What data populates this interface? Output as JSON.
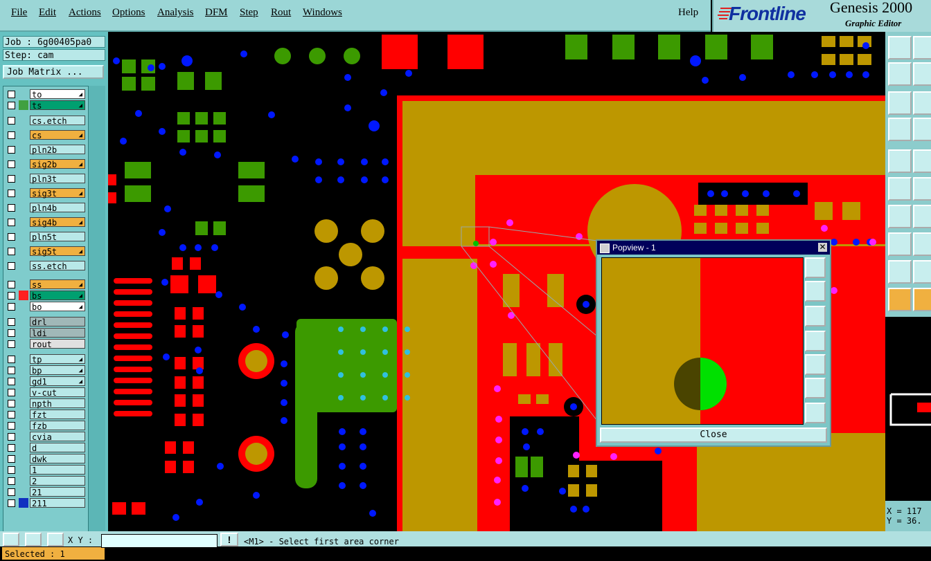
{
  "menu": [
    "File",
    "Edit",
    "Actions",
    "Options",
    "Analysis",
    "DFM",
    "Step",
    "Rout",
    "Windows"
  ],
  "help": "Help",
  "logo": {
    "brand": "Frontline",
    "product": "Genesis 2000",
    "subtitle": "Graphic Editor"
  },
  "job": "Job : 6g00405pa0",
  "step": "Step: cam",
  "job_matrix": "Job Matrix ...",
  "layers": [
    {
      "name": "to",
      "color": "#ffffff",
      "mark": "",
      "arrow": true
    },
    {
      "name": "ts",
      "color": "#00a070",
      "mark": "#40a040",
      "arrow": true
    },
    {
      "name": "cs.etch",
      "color": "#b8e8e8",
      "mark": "",
      "arrow": false
    },
    {
      "name": "cs",
      "color": "#f0b040",
      "mark": "",
      "arrow": true
    },
    {
      "name": "pln2b",
      "color": "#b8e8e8",
      "mark": "",
      "arrow": false
    },
    {
      "name": "sig2b",
      "color": "#f0b040",
      "mark": "",
      "arrow": true
    },
    {
      "name": "pln3t",
      "color": "#b8e8e8",
      "mark": "",
      "arrow": false
    },
    {
      "name": "sig3t",
      "color": "#f0b040",
      "mark": "",
      "arrow": true
    },
    {
      "name": "pln4b",
      "color": "#b8e8e8",
      "mark": "",
      "arrow": false
    },
    {
      "name": "sig4b",
      "color": "#f0b040",
      "mark": "",
      "arrow": true
    },
    {
      "name": "pln5t",
      "color": "#b8e8e8",
      "mark": "",
      "arrow": false
    },
    {
      "name": "sig5t",
      "color": "#f0b040",
      "mark": "",
      "arrow": true
    },
    {
      "name": "ss.etch",
      "color": "#b8e8e8",
      "mark": "",
      "arrow": false
    },
    {
      "name": "ss",
      "color": "#f0b040",
      "mark": "",
      "arrow": true
    },
    {
      "name": "bs",
      "color": "#00a070",
      "mark": "#ff2020",
      "arrow": true
    },
    {
      "name": "bo",
      "color": "#ffffff",
      "mark": "",
      "arrow": true
    },
    {
      "name": "drl",
      "color": "#a0b8b8",
      "mark": "",
      "arrow": false
    },
    {
      "name": "ldi",
      "color": "#a0b8b8",
      "mark": "",
      "arrow": false
    },
    {
      "name": "rout",
      "color": "#e0e0e0",
      "mark": "",
      "arrow": false
    },
    {
      "name": "tp",
      "color": "#b8e8e8",
      "mark": "",
      "arrow": true
    },
    {
      "name": "bp",
      "color": "#b8e8e8",
      "mark": "",
      "arrow": true
    },
    {
      "name": "gd1",
      "color": "#b8e8e8",
      "mark": "",
      "arrow": true
    },
    {
      "name": "v-cut",
      "color": "#b8e8e8",
      "mark": "",
      "arrow": false
    },
    {
      "name": "npth",
      "color": "#b8e8e8",
      "mark": "",
      "arrow": false
    },
    {
      "name": "fzt",
      "color": "#b8e8e8",
      "mark": "",
      "arrow": false
    },
    {
      "name": "fzb",
      "color": "#b8e8e8",
      "mark": "",
      "arrow": false
    },
    {
      "name": "cvia",
      "color": "#b8e8e8",
      "mark": "",
      "arrow": false
    },
    {
      "name": "d",
      "color": "#b8e8e8",
      "mark": "",
      "arrow": false
    },
    {
      "name": "dwk",
      "color": "#b8e8e8",
      "mark": "",
      "arrow": false
    },
    {
      "name": "1",
      "color": "#b8e8e8",
      "mark": "",
      "arrow": false
    },
    {
      "name": "2",
      "color": "#b8e8e8",
      "mark": "",
      "arrow": false
    },
    {
      "name": "21",
      "color": "#b8e8e8",
      "mark": "",
      "arrow": false
    },
    {
      "name": "211",
      "color": "#b8e8e8",
      "mark": "#1030c0",
      "arrow": false
    }
  ],
  "selected": "Selected : 1",
  "popview": {
    "title": "Popview - 1",
    "close": "Close"
  },
  "coords": {
    "x": "X = 117",
    "y": "Y = 36."
  },
  "status": {
    "xy_label": "X Y :",
    "message": "<M1> - Select first area corner"
  },
  "colors": {
    "top_copper": "#ff0000",
    "mask": "#bd9700",
    "silk": "#3c9a00",
    "via": "#0018ff",
    "drill": "#ff20ff",
    "highlight": "#00e000",
    "panel": "#66c2c2"
  },
  "popview_icons": [
    "popview-zoom-icon",
    "popview-pan-up-icon",
    "popview-pan-down-icon",
    "popview-pan-left-icon",
    "popview-pan-right-icon",
    "popview-zoom-in-icon",
    "popview-zoom-out-icon"
  ],
  "right_icons": [
    "snap-icon",
    "move-up-icon",
    "pan-left-icon",
    "home-icon",
    "fit-icon",
    "split-icon",
    "measure-icon",
    "grid-icon",
    "pin-icon",
    "net-icon",
    "cross-icon",
    "draw-icon",
    "line-icon",
    "ruler-icon",
    "pad-icon",
    "arc-icon",
    "warn-icon",
    "peak-icon",
    "pointer-icon",
    "select-icon"
  ]
}
